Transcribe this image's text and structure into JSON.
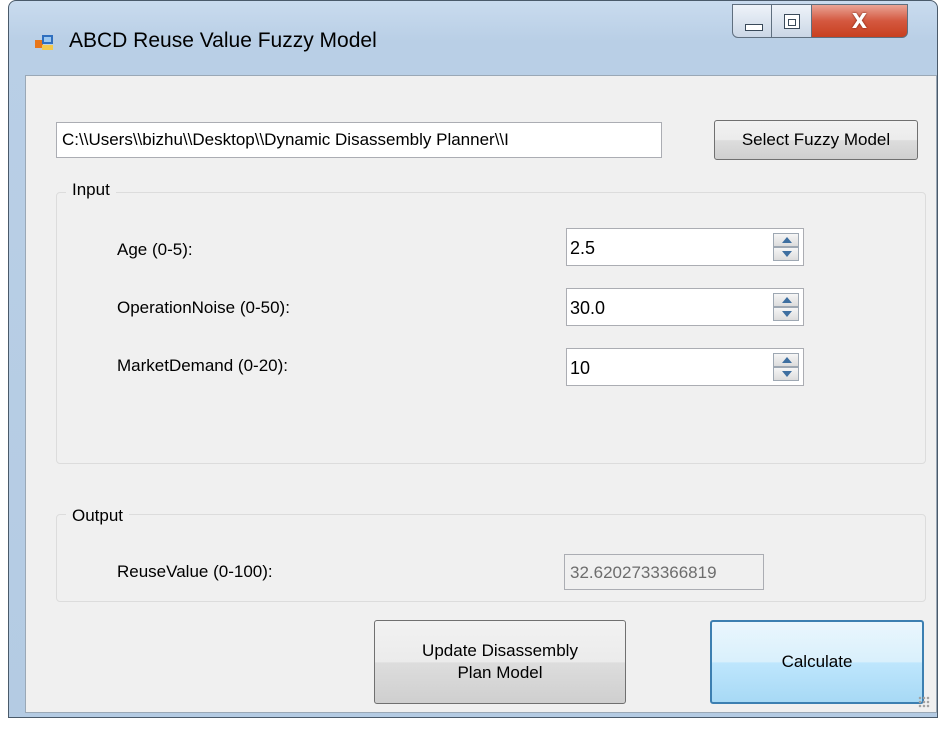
{
  "window": {
    "title": "ABCD Reuse Value Fuzzy Model",
    "close_glyph": "X",
    "icons": {
      "app": "app-window-icon",
      "minimize": "minimize-icon",
      "maximize": "maximize-icon",
      "close": "close-icon"
    }
  },
  "file": {
    "path_value": "C:\\\\Users\\\\bizhu\\\\Desktop\\\\Dynamic Disassembly Planner\\\\I",
    "select_button_label": "Select Fuzzy Model"
  },
  "input_group": {
    "legend": "Input",
    "fields": [
      {
        "label": "Age (0-5):",
        "value": "2.5"
      },
      {
        "label": "OperationNoise (0-50):",
        "value": "30.0"
      },
      {
        "label": "MarketDemand (0-20):",
        "value": "10"
      }
    ]
  },
  "output_group": {
    "legend": "Output",
    "label": "ReuseValue (0-100):",
    "value": "32.6202733366819"
  },
  "buttons": {
    "update_label": "Update Disassembly\nPlan Model",
    "calculate_label": "Calculate"
  },
  "colors": {
    "client_bg": "#f0f0f0",
    "close_button": "#c8401f",
    "default_button_border": "#3c7fb1",
    "spin_arrow": "#3e6fa0"
  }
}
